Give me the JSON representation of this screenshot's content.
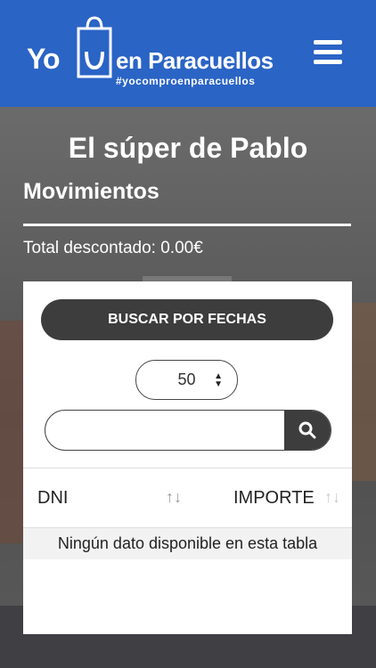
{
  "header": {
    "logo_yo": "Yo",
    "logo_text": "en Paracuellos",
    "logo_hashtag": "#yocomproenparacuellos"
  },
  "page": {
    "title": "El súper de Pablo",
    "subtitle": "Movimientos",
    "total": "Total descontado: 0.00€"
  },
  "filters": {
    "search_dates_label": "BUSCAR POR FECHAS",
    "page_size": "50",
    "search_placeholder": ""
  },
  "table": {
    "columns": [
      "DNI",
      "IMPORTE"
    ],
    "empty_message": "Ningún dato disponible en esta tabla"
  },
  "icons": {
    "menu": "hamburger-icon",
    "search": "search-icon",
    "sort": "sort-icon",
    "logo": "shopping-bag-icon"
  },
  "colors": {
    "header_bg": "#2a64c5",
    "button_bg": "#3d3d3d",
    "card_bg": "#ffffff"
  }
}
